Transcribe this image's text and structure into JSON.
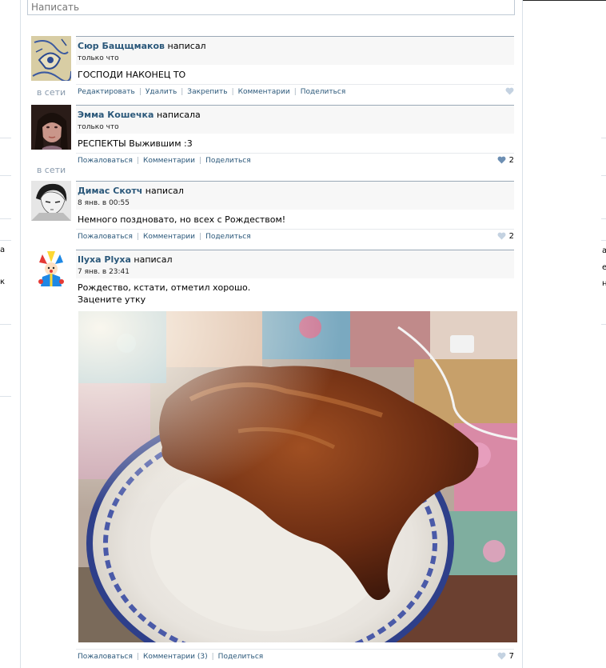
{
  "compose": {
    "placeholder": "Написать"
  },
  "online_label": "в сети",
  "posts": [
    {
      "author": "Сюр Бащщмаков",
      "verb": "написал",
      "time": "только что",
      "text": [
        "ГОСПОДИ НАКОНЕЦ ТО"
      ],
      "actions": [
        "Редактировать",
        "Удалить",
        "Закрепить",
        "Комментарии",
        "Поделиться"
      ],
      "likes": "",
      "online": true
    },
    {
      "author": "Эмма Кошечка",
      "verb": "написала",
      "time": "только что",
      "text": [
        "РЕСПЕКТЫ Выжившим :3"
      ],
      "actions": [
        "Пожаловаться",
        "Комментарии",
        "Поделиться"
      ],
      "likes": "2",
      "online": true
    },
    {
      "author": "Димас Скотч",
      "verb": "написал",
      "time": "8 янв. в 00:55",
      "text": [
        "Немного поздновато, но всех с Рождеством!"
      ],
      "actions": [
        "Пожаловаться",
        "Комментарии",
        "Поделиться"
      ],
      "likes": "2",
      "online": false
    },
    {
      "author": "Ilyxa Plyxa",
      "verb": "написал",
      "time": "7 янв. в 23:41",
      "text": [
        "Рождество, кстати, отметил хорошо.",
        "Зацените утку"
      ],
      "actions": [
        "Пожаловаться",
        "Комментарии (3)",
        "Поделиться"
      ],
      "likes": "7",
      "online": false
    }
  ],
  "colors": {
    "link": "#2b587a",
    "online": "#8a9bad",
    "like_heart_active": "#6d8fb3",
    "like_heart_inactive": "#c4d2e1"
  },
  "icons": {
    "like": "heart-icon"
  },
  "side_fragments": {
    "left": [
      "а",
      "к"
    ],
    "right": [
      "а",
      "е",
      "н"
    ]
  }
}
